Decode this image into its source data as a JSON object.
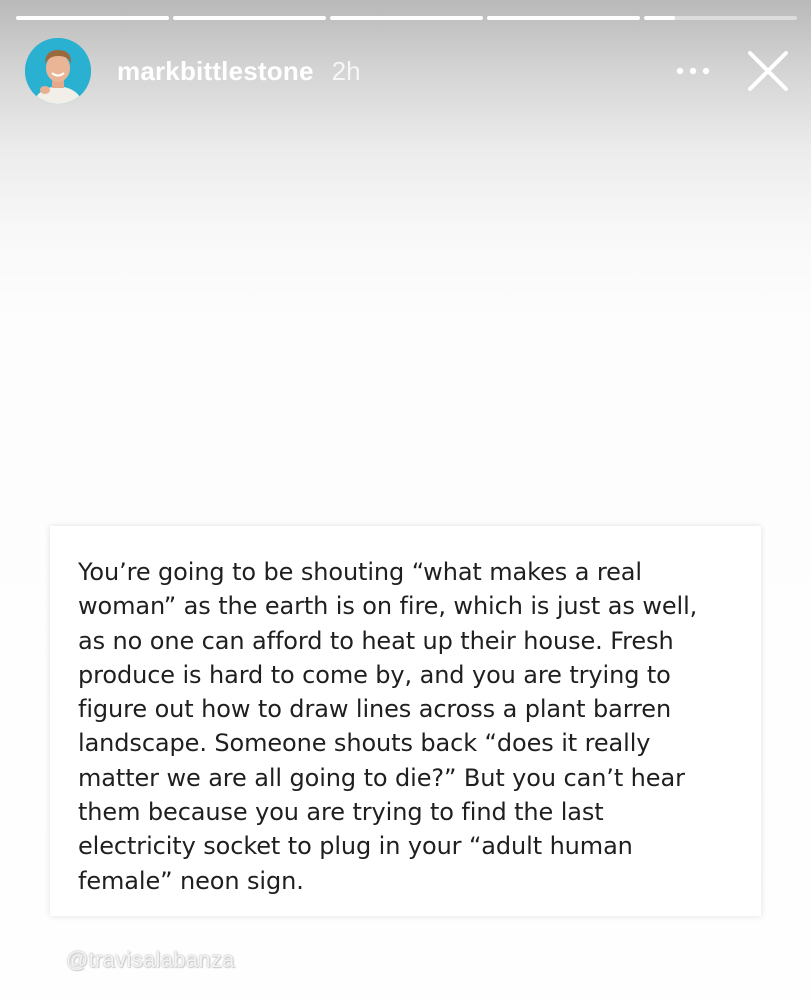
{
  "story": {
    "segments": [
      {
        "progress": 1.0
      },
      {
        "progress": 1.0
      },
      {
        "progress": 1.0
      },
      {
        "progress": 1.0
      },
      {
        "progress": 0.2
      }
    ],
    "author": {
      "username": "markbittlestone",
      "time_ago": "2h"
    },
    "icons": {
      "more": "more-horizontal-icon",
      "close": "close-icon"
    },
    "card": {
      "text": "You’re going to be shouting “what makes a real\nwoman” as the earth is on fire, which is just as well,\nas no one can afford to heat up their house. Fresh\nproduce is hard to come by, and you are trying to\nfigure out how to draw lines across a plant barren\nlandscape.  Someone shouts back “does it really\nmatter we are all going to die?” But you can’t hear\nthem because you are trying to find the last\nelectricity socket to plug in your “adult human\nfemale” neon sign."
    },
    "watermark": "@travisalabanza"
  },
  "colors": {
    "avatar_bg": "#2ab0d1",
    "header_text": "#ffffff",
    "card_bg": "#ffffff",
    "card_text": "#1f1f1f"
  }
}
